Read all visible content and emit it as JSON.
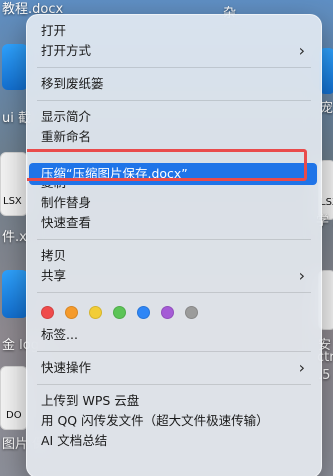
{
  "desktop": {
    "labels": {
      "top_left": "教程.docx",
      "top_right": "杂",
      "left_1": "ui 截",
      "left_2": "LSX",
      "left_3": "件.x",
      "left_4": "金 log",
      "left_5": "DO",
      "left_6": "图片 保",
      "right_1": "宠",
      "right_2": "LSX",
      "right_3": "学 度",
      "right_4": "安 位",
      "right_5": "ctr",
      "right_6": ".5"
    }
  },
  "menu": {
    "items": {
      "open": "打开",
      "open_with": "打开方式",
      "move_to_trash": "移到废纸篓",
      "get_info": "显示简介",
      "rename": "重新命名",
      "compress": "压缩“压缩图片保存.docx”",
      "duplicate": "复制",
      "make_alias": "制作替身",
      "quick_look": "快速查看",
      "copy": "拷贝",
      "share": "共享",
      "tags": "标签...",
      "quick_actions": "快速操作",
      "upload_wps": "上传到 WPS 云盘",
      "send_qq": "用 QQ 闪传发文件（超大文件极速传输）",
      "ai_summary": "AI 文档总结"
    },
    "chevrons": {
      "open_with": "›",
      "share": "›",
      "quick_actions": "›"
    },
    "tag_colors": [
      "#ef4b4b",
      "#f59a2b",
      "#f2cd36",
      "#5cc457",
      "#2f86f6",
      "#a55bd6",
      "#9b9b9b"
    ],
    "highlight_color": "#1f74e8",
    "highlight_border_color": "#e94b4b",
    "icons": {
      "submenu": "chevron-right-icon"
    }
  }
}
